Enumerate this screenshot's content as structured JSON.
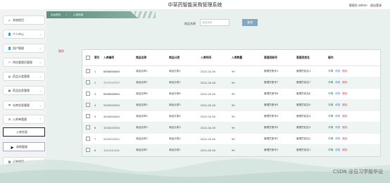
{
  "header": {
    "app_title": "中草药智能采购管理系统",
    "user_label": "管理员 admin",
    "logout_label": "退出登录"
  },
  "sidebar": {
    "items": [
      {
        "label": "系统首页",
        "icon": "home-icon",
        "glyph": "⌂"
      },
      {
        "label": "个人中心",
        "icon": "user-icon",
        "glyph": "👤"
      },
      {
        "label": "用户管理",
        "icon": "user-icon",
        "glyph": "👤"
      },
      {
        "label": "供应管理员管理",
        "icon": "users-icon",
        "glyph": "⚇"
      },
      {
        "label": "药品分类管理",
        "icon": "folder-icon",
        "glyph": "▤"
      },
      {
        "label": "药品信息管理",
        "icon": "box-icon",
        "glyph": "▦"
      },
      {
        "label": "仓库信息管理",
        "icon": "flag-icon",
        "glyph": "⚑"
      },
      {
        "label": "入库单管理",
        "icon": "list-icon",
        "glyph": "☰"
      },
      {
        "label": "订单管理",
        "icon": "grid-icon",
        "glyph": "▦"
      }
    ],
    "sub_items": [
      {
        "label": "入库信息"
      },
      {
        "label": "采购管理"
      }
    ]
  },
  "breadcrumb": {
    "home": "后台首页",
    "sep": "/",
    "current": "入库信息"
  },
  "search": {
    "label": "商品名称",
    "placeholder": "商品名称",
    "button": "查询"
  },
  "delete_button": "删除",
  "table": {
    "columns": [
      "索引",
      "入库编号",
      "商品名称",
      "商品分类",
      "入库时间",
      "入库数量",
      "管理员账号",
      "管理员姓名",
      "操作"
    ],
    "actions": {
      "detail": "详情",
      "edit": "修改",
      "delete": "删除"
    },
    "rows": [
      {
        "idx": "1",
        "code": "8888888888",
        "name": "商品名称1",
        "cat": "商品分类1",
        "date": "2021-02-26",
        "qty": "99",
        "mgr": "管理员账号1",
        "mgrn": "管理员姓名1"
      },
      {
        "idx": "2",
        "code": "7777777777",
        "name": "商品名称7",
        "cat": "商品分类7",
        "date": "2021-02-26",
        "qty": "99",
        "mgr": "管理员账号7",
        "mgrn": "管理员姓名7"
      },
      {
        "idx": "3",
        "code": "6666666666",
        "name": "商品名称6",
        "cat": "商品分类6",
        "date": "2021-02-26",
        "qty": "99",
        "mgr": "管理员账号6",
        "mgrn": "管理员姓名6"
      },
      {
        "idx": "4",
        "code": "5555555555",
        "name": "商品名称5",
        "cat": "商品分类5",
        "date": "2021-02-26",
        "qty": "99",
        "mgr": "管理员账号5",
        "mgrn": "管理员姓名5"
      },
      {
        "idx": "5",
        "code": "4444444444",
        "name": "商品名称4",
        "cat": "商品分类4",
        "date": "2021-02-26",
        "qty": "99",
        "mgr": "管理员账号4",
        "mgrn": "管理员姓名4"
      },
      {
        "idx": "6",
        "code": "3333333333",
        "name": "商品名称3",
        "cat": "商品分类3",
        "date": "2021-02-26",
        "qty": "99",
        "mgr": "管理员账号3",
        "mgrn": "管理员姓名3"
      },
      {
        "idx": "7",
        "code": "2222222222",
        "name": "商品名称2",
        "cat": "商品分类2",
        "date": "2021-02-26",
        "qty": "99",
        "mgr": "管理员账号2",
        "mgrn": "管理员姓名2"
      },
      {
        "idx": "8",
        "code": "1111111111",
        "name": "商品名称1",
        "cat": "商品分类1",
        "date": "2021-02-26",
        "qty": "99",
        "mgr": "管理员账号1",
        "mgrn": "管理员姓名1"
      }
    ]
  },
  "watermark": "CSDN @见习学姐毕设",
  "colors": {
    "accent": "#5f8e7f",
    "search_button": "#86a7c2",
    "main_bg": "#e8f1ee",
    "sidebar_bg": "#f2f4f3"
  }
}
